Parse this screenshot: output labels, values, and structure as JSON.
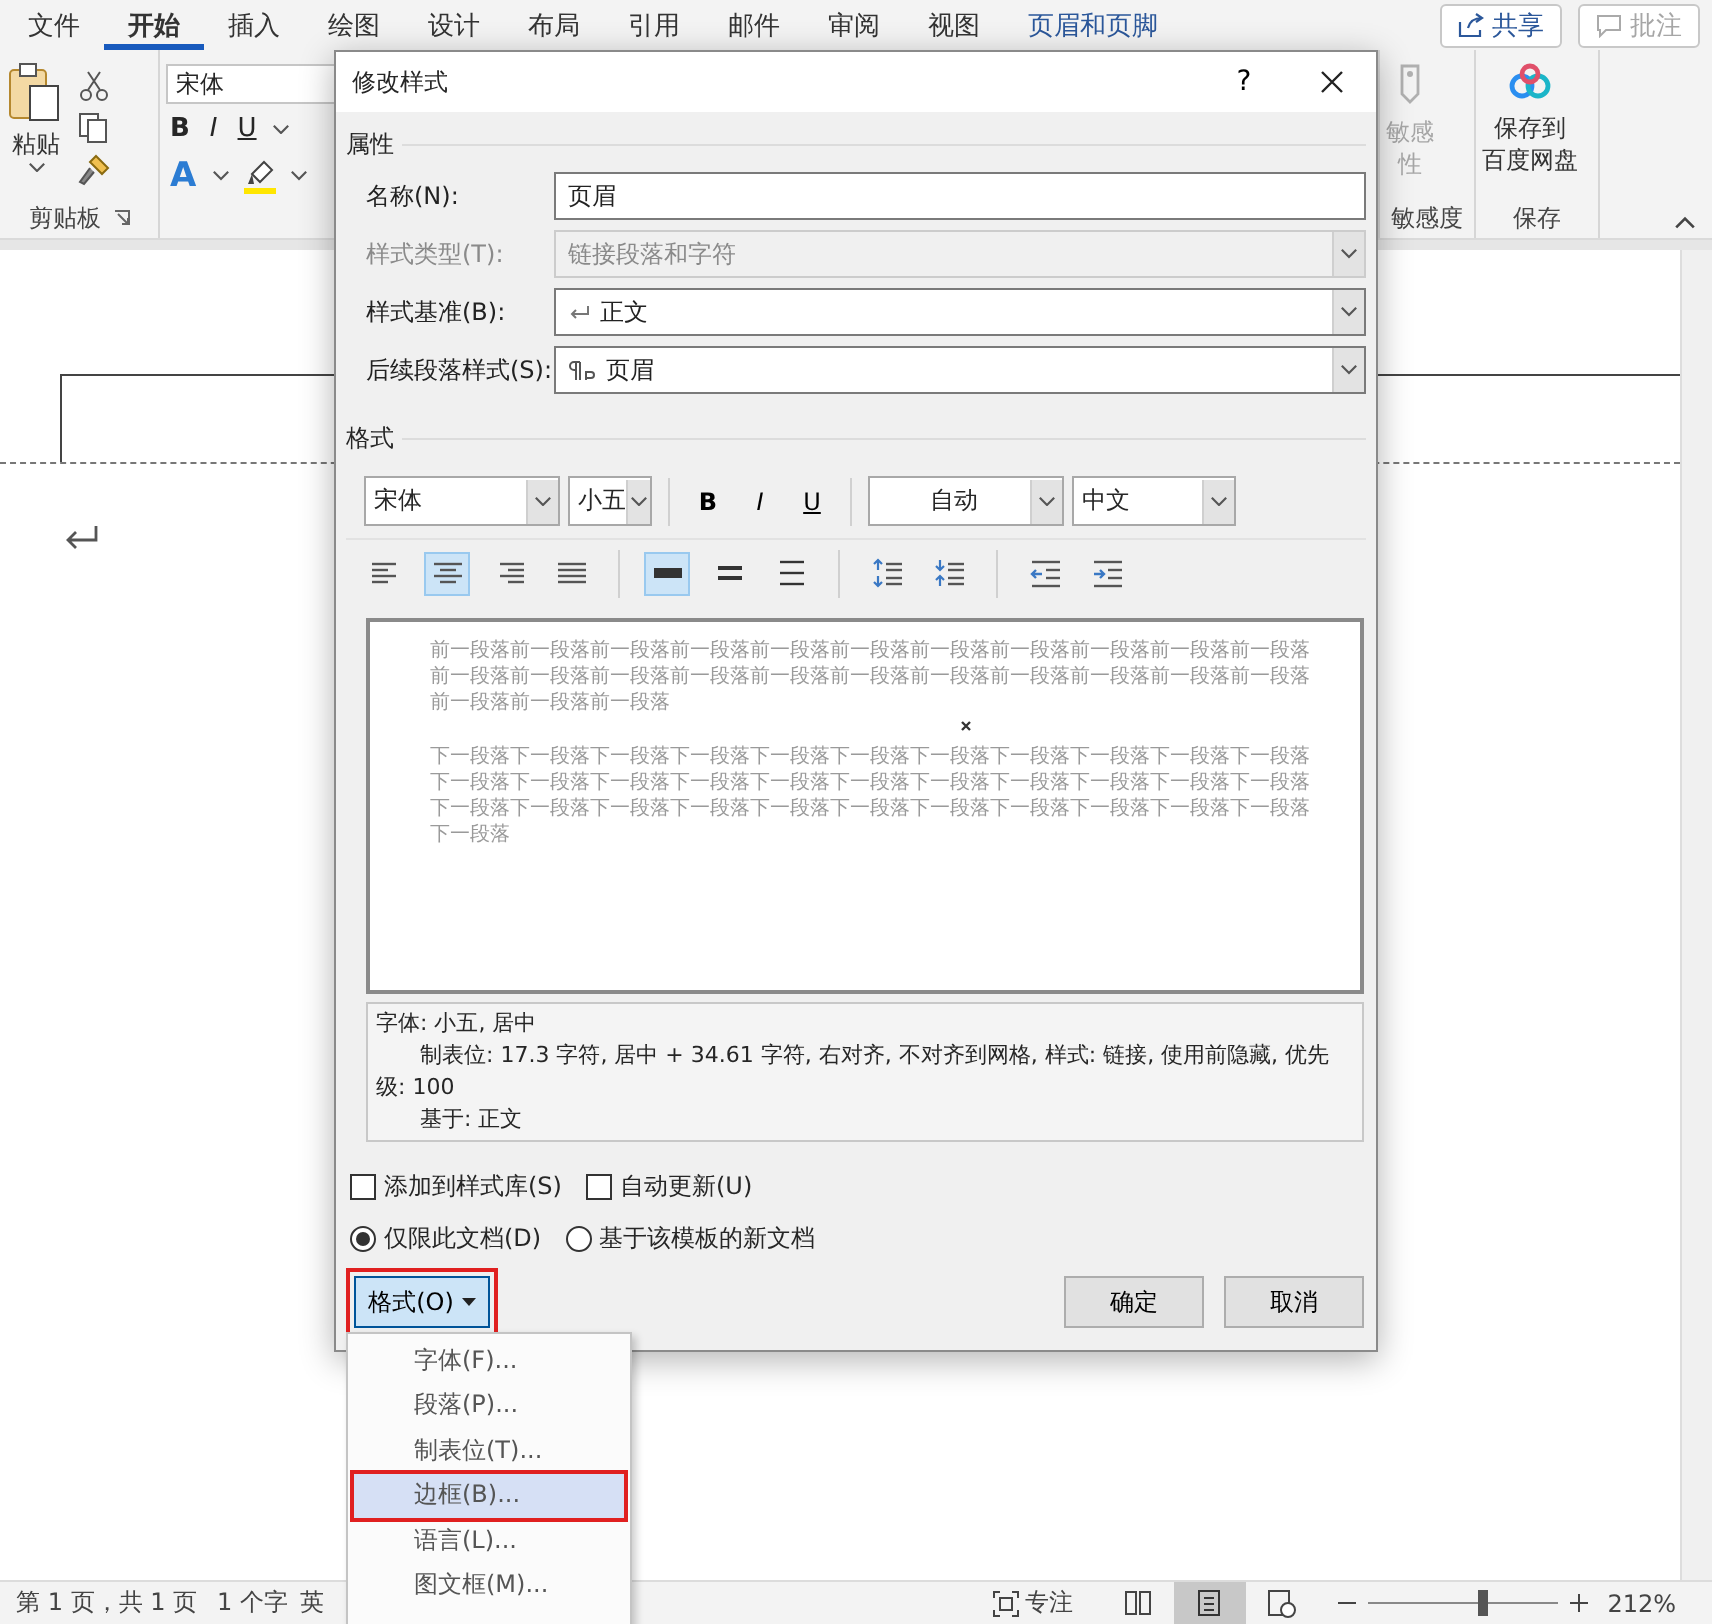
{
  "ribbon_tabs": [
    {
      "label": "文件",
      "selected": false,
      "kind": "standard"
    },
    {
      "label": "开始",
      "selected": true,
      "kind": "standard"
    },
    {
      "label": "插入",
      "selected": false,
      "kind": "standard"
    },
    {
      "label": "绘图",
      "selected": false,
      "kind": "standard"
    },
    {
      "label": "设计",
      "selected": false,
      "kind": "standard"
    },
    {
      "label": "布局",
      "selected": false,
      "kind": "standard"
    },
    {
      "label": "引用",
      "selected": false,
      "kind": "standard"
    },
    {
      "label": "邮件",
      "selected": false,
      "kind": "standard"
    },
    {
      "label": "审阅",
      "selected": false,
      "kind": "standard"
    },
    {
      "label": "视图",
      "selected": false,
      "kind": "standard"
    },
    {
      "label": "页眉和页脚",
      "selected": false,
      "kind": "contextual"
    }
  ],
  "share_button": {
    "label": "共享"
  },
  "comment_button": {
    "label": "批注",
    "disabled": true
  },
  "clipboard_group": {
    "label": "剪贴板",
    "paste_label": "粘贴"
  },
  "font_group": {
    "font_name": "宋体",
    "bold": "B",
    "italic": "I",
    "underline": "U",
    "effects_letter": "A"
  },
  "sensitivity_group": {
    "label": "敏感度",
    "button_lines": [
      "敏感",
      "性"
    ],
    "disabled": true
  },
  "save_group": {
    "label": "保存",
    "button_lines": [
      "保存到",
      "百度网盘"
    ]
  },
  "dialog": {
    "title": "修改样式",
    "help": "?",
    "properties_heading": "属性",
    "fields": [
      {
        "label": "名称(N):",
        "value": "页眉",
        "kind": "text",
        "disabled": false
      },
      {
        "label": "样式类型(T):",
        "value": "链接段落和字符",
        "kind": "select",
        "disabled": true
      },
      {
        "label": "样式基准(B):",
        "value": "正文",
        "kind": "paragraph-select",
        "disabled": false
      },
      {
        "label": "后续段落样式(S):",
        "value": "页眉",
        "kind": "linked-select",
        "disabled": false
      }
    ],
    "format_heading": "格式",
    "toolbar": {
      "font": "宋体",
      "size": "小五",
      "bold": "B",
      "italic": "I",
      "underline": "U",
      "auto_option": "自动",
      "script": "中文"
    },
    "paragraph_buttons": [
      {
        "kind": "align-left",
        "selected": false
      },
      {
        "kind": "align-center",
        "selected": true
      },
      {
        "kind": "align-right",
        "selected": false
      },
      {
        "kind": "justify",
        "selected": false
      },
      {
        "kind": "single-spacing",
        "selected": true
      },
      {
        "kind": "one-half-spacing",
        "selected": false
      },
      {
        "kind": "double-spacing",
        "selected": false
      },
      {
        "kind": "space-increase",
        "selected": false
      },
      {
        "kind": "space-decrease",
        "selected": false
      },
      {
        "kind": "indent-decrease",
        "selected": false
      },
      {
        "kind": "indent-increase",
        "selected": false
      }
    ],
    "preview": {
      "previous": "前一段落前一段落前一段落前一段落前一段落前一段落前一段落前一段落前一段落前一段落前一段落前一段落前一段落前一段落前一段落前一段落前一段落前一段落前一段落前一段落前一段落前一段落前一段落前一段落前一段落",
      "next": "下一段落下一段落下一段落下一段落下一段落下一段落下一段落下一段落下一段落下一段落下一段落下一段落下一段落下一段落下一段落下一段落下一段落下一段落下一段落下一段落下一段落下一段落下一段落下一段落下一段落下一段落下一段落下一段落下一段落下一段落下一段落下一段落下一段落下一段落"
    },
    "description": {
      "font": "字体: 小五, 居中",
      "details": "制表位:  17.3 字符, 居中 +  34.61 字符, 右对齐, 不对齐到网格, 样式: 链接, 使用前隐藏, 优先级: 100",
      "based_on": "基于: 正文"
    },
    "checkboxes": [
      {
        "label": "添加到样式库(S)",
        "checked": false
      },
      {
        "label": "自动更新(U)",
        "checked": false
      }
    ],
    "radios": [
      {
        "label": "仅限此文档(D)",
        "selected": true
      },
      {
        "label": "基于该模板的新文档",
        "selected": false
      }
    ],
    "format_button": {
      "label": "格式(O)",
      "annotated": true
    },
    "ok_button": "确定",
    "cancel_button": "取消"
  },
  "format_menu": [
    {
      "label": "字体(F)...",
      "selected": false,
      "annotated": false
    },
    {
      "label": "段落(P)...",
      "selected": false,
      "annotated": false
    },
    {
      "label": "制表位(T)...",
      "selected": false,
      "annotated": false
    },
    {
      "label": "边框(B)...",
      "selected": true,
      "annotated": true
    },
    {
      "label": "语言(L)...",
      "selected": false,
      "annotated": false
    },
    {
      "label": "图文框(M)...",
      "selected": false,
      "annotated": false
    }
  ],
  "status_bar": {
    "page": "第 1 页，共 1 页",
    "words": "1 个字",
    "language": "英",
    "focus": "专注",
    "views": [
      {
        "kind": "read",
        "selected": false
      },
      {
        "kind": "print",
        "selected": true
      },
      {
        "kind": "web",
        "selected": false
      }
    ],
    "zoom": {
      "level": 0.6,
      "reading": "212%"
    }
  }
}
